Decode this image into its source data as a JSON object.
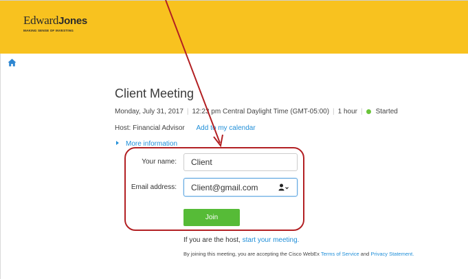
{
  "header": {
    "logo_word1": "Edward",
    "logo_word2": "Jones",
    "logo_tagline": "MAKING SENSE OF INVESTING",
    "bg_color": "#f8c21f"
  },
  "nav": {
    "home_icon": "home-icon"
  },
  "meeting": {
    "title": "Client Meeting",
    "date": "Monday, July 31, 2017",
    "time": "12:23 pm Central Daylight Time (GMT-05:00)",
    "duration": "1 hour",
    "status": "Started",
    "status_color": "#6ac43a",
    "host": "Host: Financial Advisor",
    "add_calendar": "Add to my calendar",
    "more_info": "More information"
  },
  "form": {
    "name_label": "Your name:",
    "name_value": "Client",
    "email_label": "Email address:",
    "email_value": "Client@gmail.com",
    "join_label": "Join",
    "join_color": "#56bb37"
  },
  "footer": {
    "host_prefix": "If you are the host,",
    "start_meeting": "start your meeting.",
    "accept_text": "By joining this meeting, you are accepting the Cisco WebEx",
    "terms": "Terms of Service",
    "and": "and",
    "privacy": "Privacy Statement."
  },
  "annotation": {
    "color": "#b21f22"
  }
}
